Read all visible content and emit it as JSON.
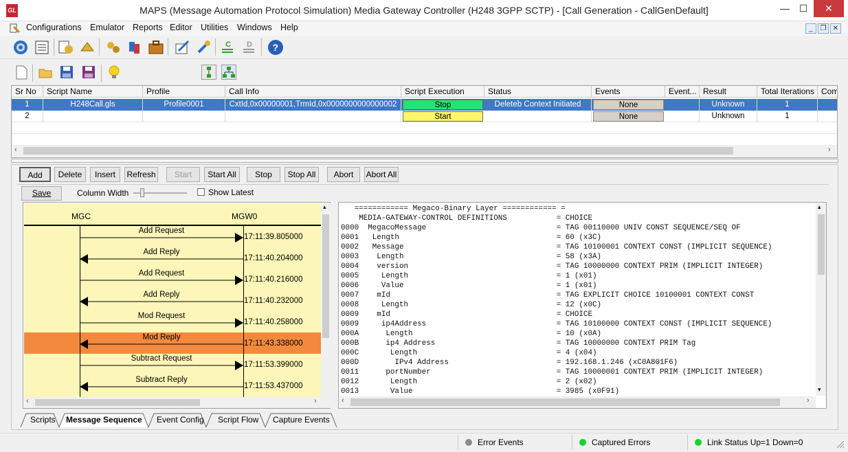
{
  "window": {
    "title": "MAPS (Message Automation Protocol Simulation) Media Gateway Controller (H248 3GPP SCTP) - [Call Generation  - CallGenDefault]",
    "logo_text": "GL",
    "minimize": "—",
    "maximize": "☐",
    "close": "✕"
  },
  "menu": [
    "Configurations",
    "Emulator",
    "Reports",
    "Editor",
    "Utilities",
    "Windows",
    "Help"
  ],
  "mdi": {
    "min": "_",
    "restore": "❐",
    "close": "✕"
  },
  "grid": {
    "headers": [
      "Sr No",
      "Script Name",
      "Profile",
      "Call Info",
      "Script Execution",
      "Status",
      "Events",
      "Event...",
      "Result",
      "Total Iterations",
      "Com"
    ],
    "rows": [
      {
        "sr": "1",
        "script": "H248Call.gls",
        "profile": "Profile0001",
        "callinfo": "CxtId,0x00000001,TrmId,0x0000000000000002",
        "exec": "Stop",
        "status": "Deleteb Context Initiated",
        "events": "None",
        "result": "Unknown",
        "iterations": "1"
      },
      {
        "sr": "2",
        "script": "",
        "profile": "",
        "callinfo": "",
        "exec": "Start",
        "status": "",
        "events": "None",
        "result": "Unknown",
        "iterations": "1"
      }
    ]
  },
  "buttons": {
    "add": "Add",
    "delete": "Delete",
    "insert": "Insert",
    "refresh": "Refresh",
    "start": "Start",
    "start_all": "Start All",
    "stop": "Stop",
    "stop_all": "Stop All",
    "abort": "Abort",
    "abort_all": "Abort All"
  },
  "seq_toolbar": {
    "save": "Save",
    "column_width": "Column Width",
    "show_latest": "Show Latest"
  },
  "sequence": {
    "left_entity": "MGC",
    "right_entity": "MGW0",
    "messages": [
      {
        "label": "Add Request",
        "time": "17:11:39.805000",
        "dir": "right"
      },
      {
        "label": "Add Reply",
        "time": "17:11:40.204000",
        "dir": "left"
      },
      {
        "label": "Add Request",
        "time": "17:11:40.216000",
        "dir": "right"
      },
      {
        "label": "Add Reply",
        "time": "17:11:40.232000",
        "dir": "left"
      },
      {
        "label": "Mod Request",
        "time": "17:11:40.258000",
        "dir": "right"
      },
      {
        "label": "Mod Reply",
        "time": "17:11:43.338000",
        "dir": "left",
        "highlight": true
      },
      {
        "label": "Subtract Request",
        "time": "17:11:53.399000",
        "dir": "right"
      },
      {
        "label": "Subtract Reply",
        "time": "17:11:53.437000",
        "dir": "left"
      }
    ]
  },
  "decode_lines": [
    "   ============ Megaco-Binary Layer ============ =",
    "    MEDIA-GATEWAY-CONTROL DEFINITIONS           = CHOICE",
    "0000  MegacoMessage                             = TAG 00110000 UNIV CONST SEQUENCE/SEQ OF",
    "0001   Length                                   = 60 (x3C)",
    "0002   Message                                  = TAG 10100001 CONTEXT CONST (IMPLICIT SEQUENCE)",
    "0003    Length                                  = 58 (x3A)",
    "0004    version                                 = TAG 10000000 CONTEXT PRIM (IMPLICIT INTEGER)",
    "0005     Length                                 = 1 (x01)",
    "0006     Value                                  = 1 (x01)",
    "0007    mId                                     = TAG EXPLICIT CHOICE 10100001 CONTEXT CONST",
    "0008     Length                                 = 12 (x0C)",
    "0009    mId                                     = CHOICE",
    "0009     ip4Address                             = TAG 10100000 CONTEXT CONST (IMPLICIT SEQUENCE)",
    "000A      Length                                = 10 (x0A)",
    "000B      ip4 Address                           = TAG 10000000 CONTEXT PRIM Tag",
    "000C       Length                               = 4 (x04)",
    "000D        IPv4 Address                        = 192.168.1.246 (xC0A801F6)",
    "0011      portNumber                            = TAG 10000001 CONTEXT PRIM (IMPLICIT INTEGER)",
    "0012       Length                               = 2 (x02)",
    "0013       Value                                = 3985 (x0F91)"
  ],
  "tabs": [
    {
      "label": "Scripts",
      "active": false
    },
    {
      "label": "Message Sequence",
      "active": true
    },
    {
      "label": "Event Config",
      "active": false
    },
    {
      "label": "Script Flow",
      "active": false
    },
    {
      "label": "Capture Events",
      "active": false
    }
  ],
  "status": {
    "error_events": "Error Events",
    "captured_errors": "Captured Errors",
    "link_status": "Link Status Up=1 Down=0"
  },
  "colors": {
    "selection": "#3f78c6",
    "stop_green": "#24e27a",
    "start_yellow": "#fdf56a",
    "seq_bg": "#fcf6b8",
    "seq_highlight": "#f2893d",
    "led_green": "#1bd12d",
    "led_gray": "#8a8a8a"
  }
}
